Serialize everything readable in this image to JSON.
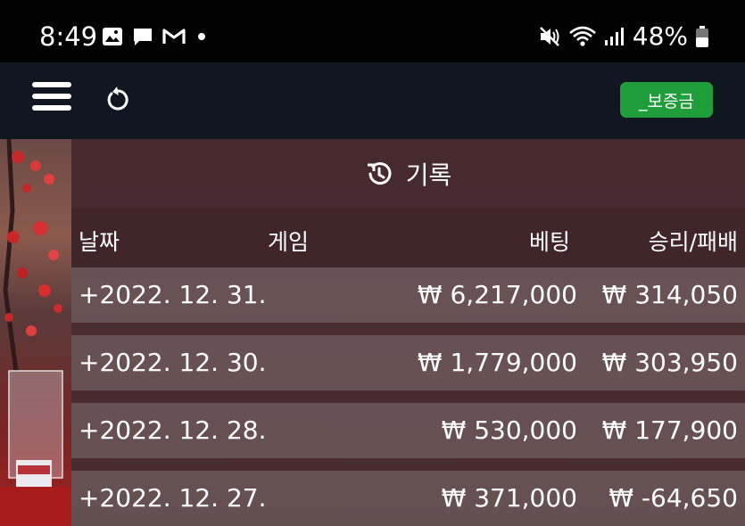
{
  "status_bar": {
    "time": "8:49",
    "battery": "48%",
    "left_icons": [
      "image-icon",
      "chat-icon",
      "gmail-icon",
      "dot-icon"
    ],
    "right_icons": [
      "mute-icon",
      "wifi-icon",
      "signal-icon",
      "battery-icon"
    ]
  },
  "app_bar": {
    "deposit_label": "_보증금"
  },
  "panel": {
    "title": "기록",
    "columns": {
      "date": "날짜",
      "game": "게임",
      "bet": "베팅",
      "result": "승리/패배"
    },
    "rows": [
      {
        "date": "+2022. 12. 31.",
        "game": "",
        "bet": "₩ 6,217,000",
        "result": "₩ 314,050"
      },
      {
        "date": "+2022. 12. 30.",
        "game": "",
        "bet": "₩ 1,779,000",
        "result": "₩ 303,950"
      },
      {
        "date": "+2022. 12. 28.",
        "game": "",
        "bet": "₩ 530,000",
        "result": "₩ 177,900"
      },
      {
        "date": "+2022. 12. 27.",
        "game": "",
        "bet": "₩ 371,000",
        "result": "₩ -64,650"
      }
    ]
  }
}
